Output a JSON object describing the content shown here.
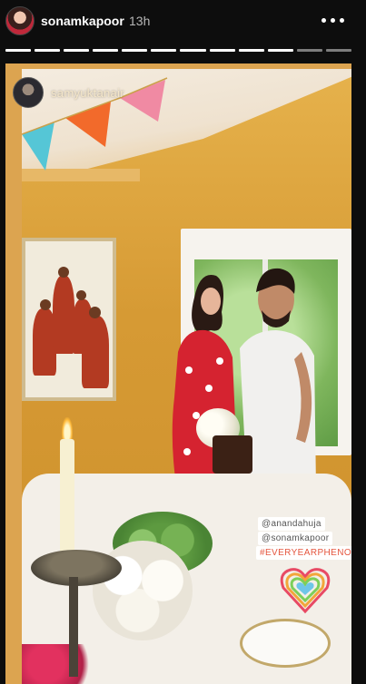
{
  "header": {
    "username": "sonamkapoor",
    "time_ago": "13h"
  },
  "progress": {
    "segment_count": 12,
    "current_index": 9
  },
  "story": {
    "tagged_user": "samyuktanair",
    "mentions": [
      "@anandahuja",
      "@sonamkapoor"
    ],
    "hashtag": "#EVERYEARPHENOMAL"
  },
  "colors": {
    "header_background": "#0d0d0d",
    "wall": "#d99a3a",
    "hashtag": "#e5563f"
  }
}
